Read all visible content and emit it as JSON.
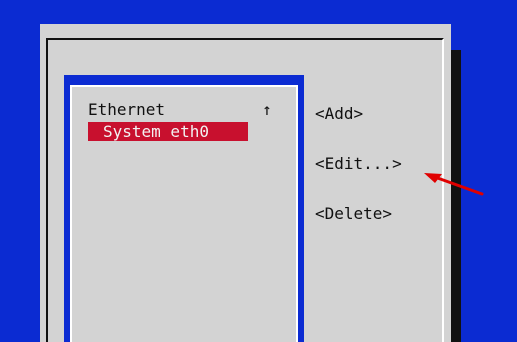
{
  "list": {
    "group_label": "Ethernet",
    "scroll_indicator": "↑",
    "selected_item": "System eth0"
  },
  "actions": {
    "add": "<Add>",
    "edit": "<Edit...>",
    "delete": "<Delete>"
  },
  "colors": {
    "background_blue": "#0b2bd2",
    "dialog_gray": "#d3d3d3",
    "selection_red": "#c8102e",
    "annotation_red": "#e00000"
  },
  "annotation": {
    "icon": "red-pointer-arrow-icon"
  }
}
